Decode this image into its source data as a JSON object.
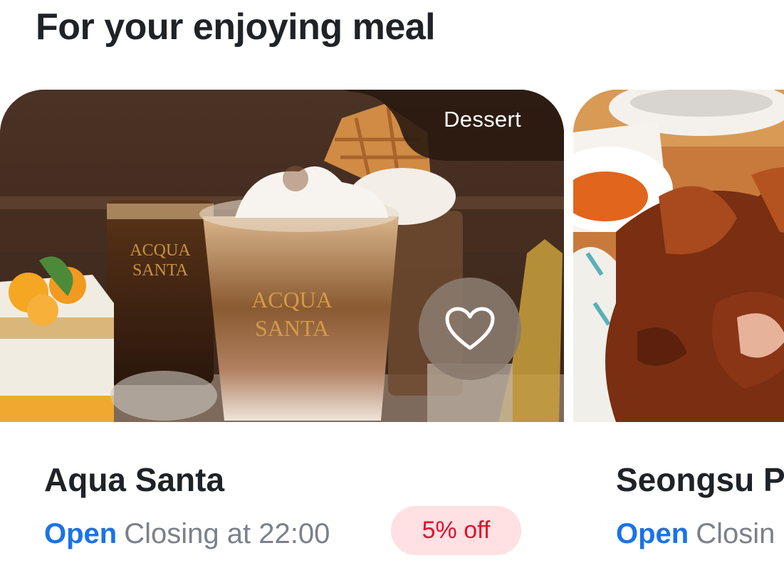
{
  "section": {
    "title": "For your enjoying meal"
  },
  "restaurants": [
    {
      "name": "Aqua Santa",
      "category": "Dessert",
      "status": "Open",
      "hours": "Closing at 22:00",
      "discount": "5% off",
      "favorited": false,
      "photo_text": [
        "ACQUA",
        "SANTA"
      ]
    },
    {
      "name": "Seongsu P",
      "status": "Open",
      "hours": "Closin"
    }
  ],
  "colors": {
    "title_text": "#1f2328",
    "open_status": "#1a73e8",
    "hours_text": "#7b818a",
    "discount_bg": "#ffe0e3",
    "discount_text": "#e3102a",
    "favorite_bg": "#8a7a6e"
  },
  "icons": {
    "favorite": "heart-outline-icon"
  }
}
